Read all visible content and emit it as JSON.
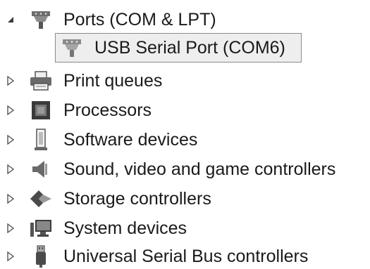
{
  "tree": {
    "expanded_category": {
      "label": "Ports (COM & LPT)",
      "icon": "port-connector-icon",
      "toggle": "expanded-arrow-icon"
    },
    "selected_child": {
      "label": "USB Serial Port (COM6)",
      "icon": "port-connector-icon"
    },
    "categories": [
      {
        "label": "Print queues",
        "icon": "printer-icon"
      },
      {
        "label": "Processors",
        "icon": "processor-chip-icon"
      },
      {
        "label": "Software devices",
        "icon": "software-device-icon"
      },
      {
        "label": "Sound, video and game controllers",
        "icon": "speaker-icon"
      },
      {
        "label": "Storage controllers",
        "icon": "storage-controller-icon"
      },
      {
        "label": "System devices",
        "icon": "monitor-icon"
      },
      {
        "label": "Universal Serial Bus controllers",
        "icon": "usb-plug-icon"
      }
    ]
  }
}
